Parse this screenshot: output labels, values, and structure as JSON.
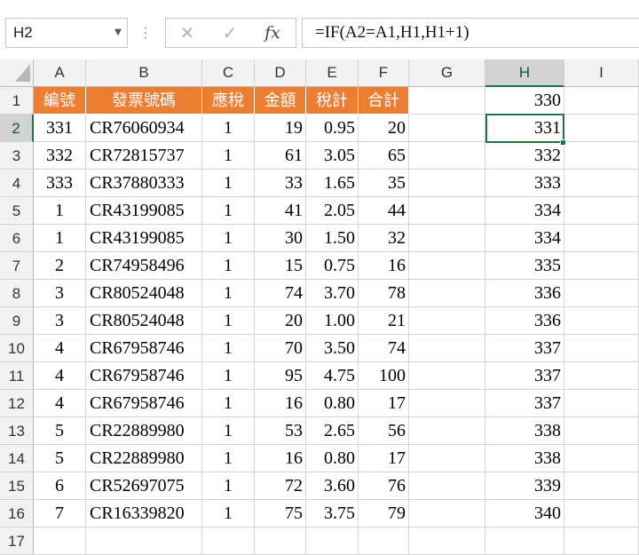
{
  "name_box": "H2",
  "formula": "=IF(A2=A1,H1,H1+1)",
  "formula_buttons": {
    "cancel": "✕",
    "enter": "✓",
    "fx": "fx"
  },
  "columns": [
    "A",
    "B",
    "C",
    "D",
    "E",
    "F",
    "G",
    "H",
    "I"
  ],
  "selected_column": "H",
  "selected_row": 2,
  "accent_color": "#ed7d31",
  "selection_color": "#217346",
  "header_row": [
    "編號",
    "發票號碼",
    "應稅",
    "金額",
    "稅計",
    "合計"
  ],
  "rows": [
    {
      "num": "1",
      "a": "",
      "b": "",
      "c": "",
      "d": "",
      "e": "",
      "f": "",
      "h": "330"
    },
    {
      "num": "2",
      "a": "331",
      "b": "CR76060934",
      "c": "1",
      "d": "19",
      "e": "0.95",
      "f": "20",
      "h": "331"
    },
    {
      "num": "3",
      "a": "332",
      "b": "CR72815737",
      "c": "1",
      "d": "61",
      "e": "3.05",
      "f": "65",
      "h": "332"
    },
    {
      "num": "4",
      "a": "333",
      "b": "CR37880333",
      "c": "1",
      "d": "33",
      "e": "1.65",
      "f": "35",
      "h": "333"
    },
    {
      "num": "5",
      "a": "1",
      "b": "CR43199085",
      "c": "1",
      "d": "41",
      "e": "2.05",
      "f": "44",
      "h": "334"
    },
    {
      "num": "6",
      "a": "1",
      "b": "CR43199085",
      "c": "1",
      "d": "30",
      "e": "1.50",
      "f": "32",
      "h": "334"
    },
    {
      "num": "7",
      "a": "2",
      "b": "CR74958496",
      "c": "1",
      "d": "15",
      "e": "0.75",
      "f": "16",
      "h": "335"
    },
    {
      "num": "8",
      "a": "3",
      "b": "CR80524048",
      "c": "1",
      "d": "74",
      "e": "3.70",
      "f": "78",
      "h": "336"
    },
    {
      "num": "9",
      "a": "3",
      "b": "CR80524048",
      "c": "1",
      "d": "20",
      "e": "1.00",
      "f": "21",
      "h": "336"
    },
    {
      "num": "10",
      "a": "4",
      "b": "CR67958746",
      "c": "1",
      "d": "70",
      "e": "3.50",
      "f": "74",
      "h": "337"
    },
    {
      "num": "11",
      "a": "4",
      "b": "CR67958746",
      "c": "1",
      "d": "95",
      "e": "4.75",
      "f": "100",
      "h": "337"
    },
    {
      "num": "12",
      "a": "4",
      "b": "CR67958746",
      "c": "1",
      "d": "16",
      "e": "0.80",
      "f": "17",
      "h": "337"
    },
    {
      "num": "13",
      "a": "5",
      "b": "CR22889980",
      "c": "1",
      "d": "53",
      "e": "2.65",
      "f": "56",
      "h": "338"
    },
    {
      "num": "14",
      "a": "5",
      "b": "CR22889980",
      "c": "1",
      "d": "16",
      "e": "0.80",
      "f": "17",
      "h": "338"
    },
    {
      "num": "15",
      "a": "6",
      "b": "CR52697075",
      "c": "1",
      "d": "72",
      "e": "3.60",
      "f": "76",
      "h": "339"
    },
    {
      "num": "16",
      "a": "7",
      "b": "CR16339820",
      "c": "1",
      "d": "75",
      "e": "3.75",
      "f": "79",
      "h": "340"
    },
    {
      "num": "17",
      "a": "",
      "b": "",
      "c": "",
      "d": "",
      "e": "",
      "f": "",
      "h": ""
    }
  ]
}
